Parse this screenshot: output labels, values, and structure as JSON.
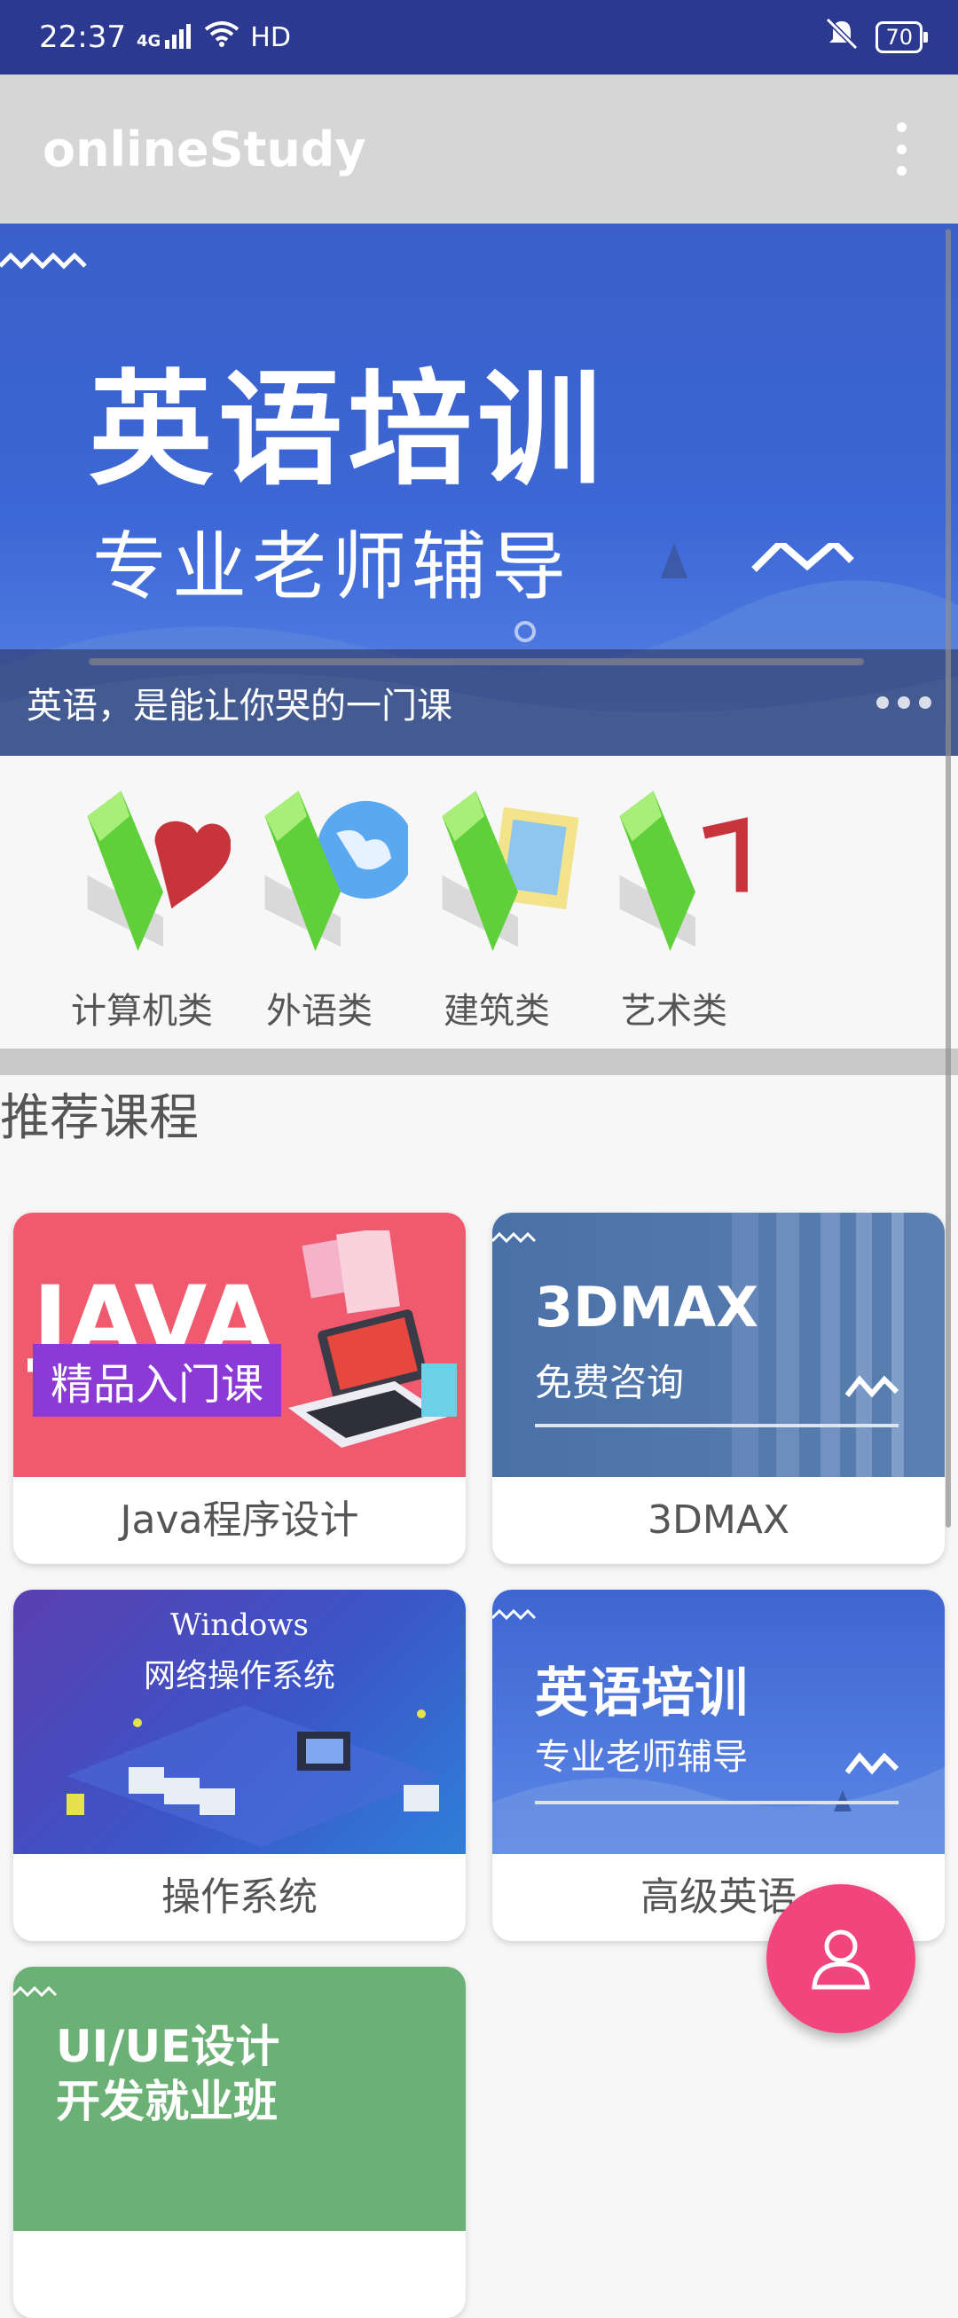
{
  "status_bar": {
    "time": "22:37",
    "network": "4G",
    "hd": "HD",
    "battery": "70",
    "icons": [
      "signal-icon",
      "wifi-icon",
      "vibrate-icon",
      "battery-icon"
    ]
  },
  "app_bar": {
    "title": "onlineStudy",
    "menu_icon": "more-vert-icon"
  },
  "banner": {
    "headline": "英语培训",
    "subline": "专业老师辅导",
    "caption": "英语，是能让你哭的一门课",
    "page_count": 3
  },
  "categories": [
    {
      "label": "计算机类",
      "icon": "folder-heart-icon"
    },
    {
      "label": "外语类",
      "icon": "folder-globe-icon"
    },
    {
      "label": "建筑类",
      "icon": "folder-picture-icon"
    },
    {
      "label": "艺术类",
      "icon": "folder-music-icon"
    }
  ],
  "section_title": "推荐课程",
  "courses": [
    {
      "name": "Java程序设计",
      "thumb_title": "JAVA",
      "thumb_badge": "精品入门课"
    },
    {
      "name": "3DMAX",
      "thumb_title": "3DMAX",
      "thumb_sub": "免费咨询"
    },
    {
      "name": "操作系统",
      "thumb_title": "Windows",
      "thumb_sub": "网络操作系统"
    },
    {
      "name": "高级英语",
      "thumb_title": "英语培训",
      "thumb_sub": "专业老师辅导"
    },
    {
      "name": "",
      "thumb_title": "UI/UE设计",
      "thumb_sub": "开发就业班"
    }
  ],
  "fab": {
    "icon": "person-icon"
  },
  "colors": {
    "status_bar": "#2b3990",
    "app_bar": "#d6d6d6",
    "fab": "#f2457e",
    "java_bg": "#f05a6e",
    "max_bg": "#4a70a8",
    "os_bg": "#3b4fc0",
    "en_bg": "#4a6fd8",
    "ui_bg": "#6bb074"
  }
}
